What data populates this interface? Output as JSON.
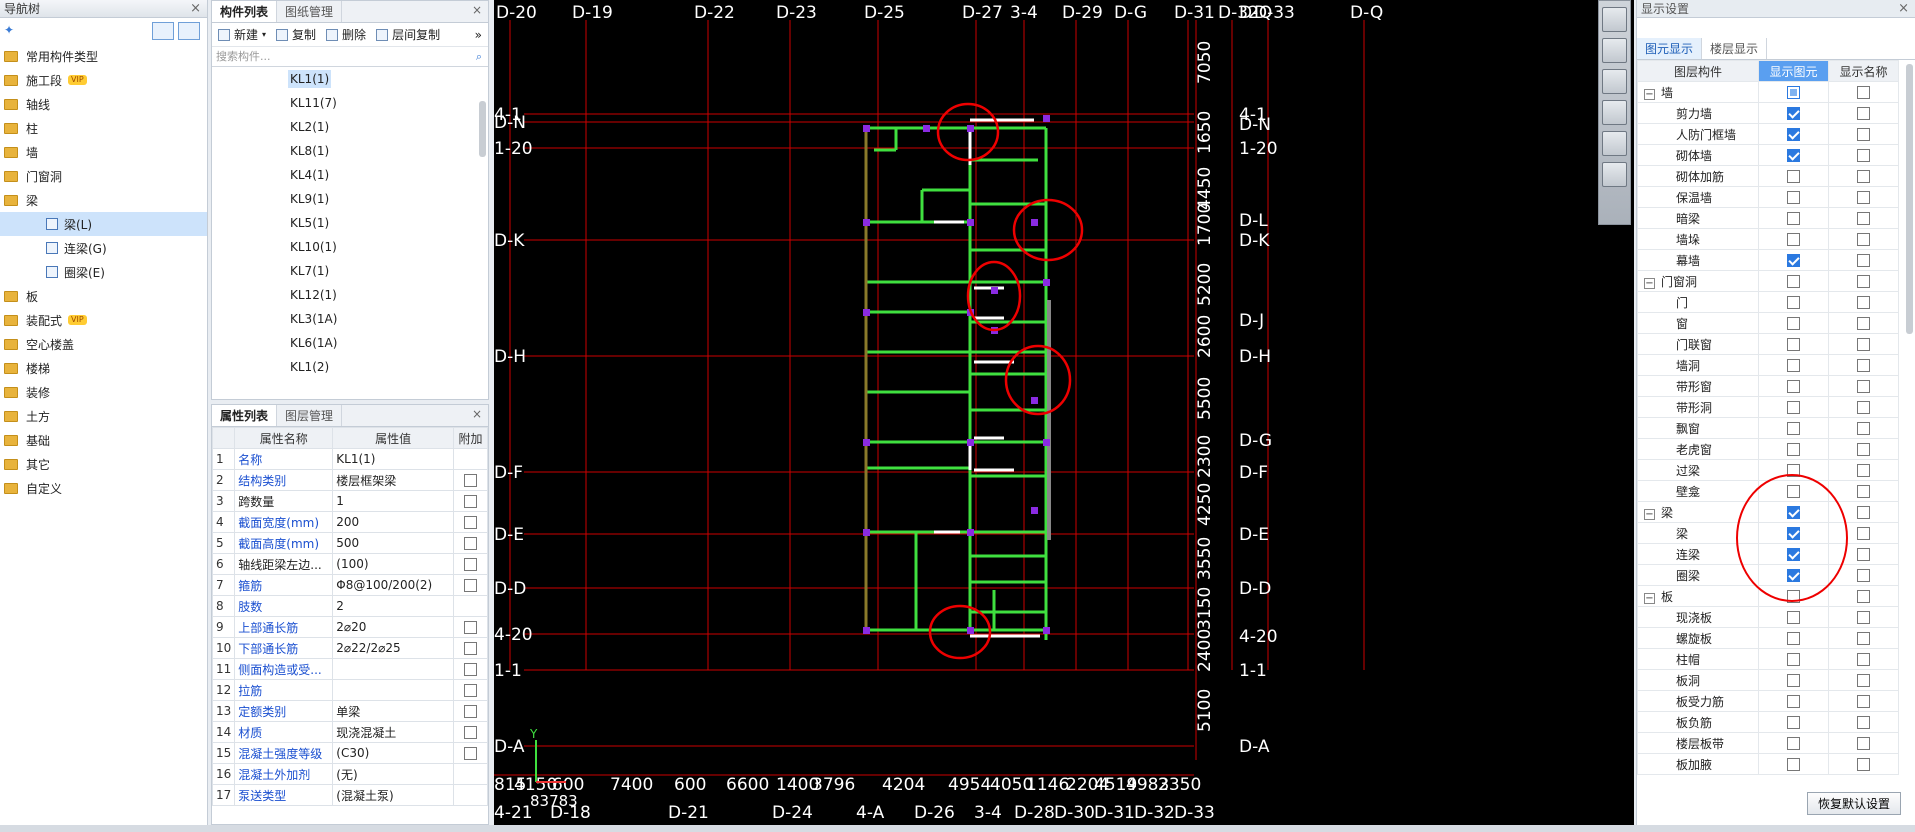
{
  "nav": {
    "title": "导航树",
    "items": [
      {
        "label": "常用构件类型"
      },
      {
        "label": "施工段",
        "badge": "VIP"
      },
      {
        "label": "轴线"
      },
      {
        "label": "柱"
      },
      {
        "label": "墙"
      },
      {
        "label": "门窗洞"
      },
      {
        "label": "梁"
      },
      {
        "label": "梁(L)"
      },
      {
        "label": "连梁(G)"
      },
      {
        "label": "圈梁(E)"
      },
      {
        "label": "板"
      },
      {
        "label": "装配式",
        "badge": "VIP"
      },
      {
        "label": "空心楼盖"
      },
      {
        "label": "楼梯"
      },
      {
        "label": "装修"
      },
      {
        "label": "土方"
      },
      {
        "label": "基础"
      },
      {
        "label": "其它"
      },
      {
        "label": "自定义"
      }
    ]
  },
  "components": {
    "tabs": [
      "构件列表",
      "图纸管理"
    ],
    "toolbar": {
      "new": "新建",
      "copy": "复制",
      "delete": "删除",
      "floor_copy": "层间复制"
    },
    "search_placeholder": "搜索构件...",
    "items": [
      "KL1(1)",
      "KL11(7)",
      "KL2(1)",
      "KL8(1)",
      "KL4(1)",
      "KL9(1)",
      "KL5(1)",
      "KL10(1)",
      "KL7(1)",
      "KL12(1)",
      "KL3(1A)",
      "KL6(1A)",
      "KL1(2)"
    ]
  },
  "properties": {
    "tabs": [
      "属性列表",
      "图层管理"
    ],
    "headers": [
      "属性名称",
      "属性值",
      "附加"
    ],
    "rows": [
      {
        "n": "1",
        "k": "名称",
        "v": "KL1(1)",
        "cb": false
      },
      {
        "n": "2",
        "k": "结构类别",
        "v": "楼层框架梁",
        "cb": true
      },
      {
        "n": "3",
        "k": "跨数量",
        "v": "1",
        "cb": true
      },
      {
        "n": "4",
        "k": "截面宽度(mm)",
        "v": "200",
        "cb": true
      },
      {
        "n": "5",
        "k": "截面高度(mm)",
        "v": "500",
        "cb": true
      },
      {
        "n": "6",
        "k": "轴线距梁左边...",
        "v": "(100)",
        "cb": true
      },
      {
        "n": "7",
        "k": "箍筋",
        "v": "Φ8@100/200(2)",
        "cb": true
      },
      {
        "n": "8",
        "k": "肢数",
        "v": "2",
        "cb": false
      },
      {
        "n": "9",
        "k": "上部通长筋",
        "v": "2⌀20",
        "cb": true
      },
      {
        "n": "10",
        "k": "下部通长筋",
        "v": "2⌀22/2⌀25",
        "cb": true
      },
      {
        "n": "11",
        "k": "侧面构造或受...",
        "v": "",
        "cb": true
      },
      {
        "n": "12",
        "k": "拉筋",
        "v": "",
        "cb": true
      },
      {
        "n": "13",
        "k": "定额类别",
        "v": "单梁",
        "cb": true
      },
      {
        "n": "14",
        "k": "材质",
        "v": "现浇混凝土",
        "cb": true
      },
      {
        "n": "15",
        "k": "混凝土强度等级",
        "v": "(C30)",
        "cb": true
      },
      {
        "n": "16",
        "k": "混凝土外加剂",
        "v": "(无)",
        "cb": false
      },
      {
        "n": "17",
        "k": "泵送类型",
        "v": "(混凝土泵)",
        "cb": false
      }
    ]
  },
  "canvas": {
    "top_axes": [
      "D-20",
      "D-19",
      "D-22",
      "D-23",
      "D-25",
      "D-27",
      "3-4",
      "D-29",
      "D-G",
      "D-31",
      "D-32",
      "D-33",
      "D-Q"
    ],
    "left_axes": [
      "4-1",
      "D-N",
      "1-20",
      "D-K",
      "D-H",
      "D-F",
      "D-E",
      "D-D",
      "4-20",
      "1-1",
      "D-A"
    ],
    "right_axes": [
      "D-Q",
      "4-1",
      "D-N",
      "1-20",
      "D-L",
      "D-K",
      "D-J",
      "D-H",
      "D-G",
      "D-F",
      "D-E",
      "D-D",
      "4-20",
      "1-1",
      "D-A"
    ],
    "right_dims": [
      "7050",
      "1650",
      "4450",
      "1700",
      "5200",
      "2600",
      "5500",
      "2300",
      "4250",
      "3550",
      "3150",
      "2400",
      "5100"
    ],
    "bottom_dims": [
      "815",
      "4150",
      "600",
      "7400",
      "600",
      "6600",
      "1400",
      "3796",
      "4204",
      "4954",
      "4050",
      "1146",
      "2204",
      "4519",
      "4983",
      "2350"
    ],
    "bottom_total": "83783",
    "bottom_axes": [
      "4-21",
      "D-18",
      "D-21",
      "D-24",
      "4-A",
      "D-26",
      "3-4",
      "D-28",
      "D-30",
      "D-31",
      "D-32",
      "D-33"
    ]
  },
  "display": {
    "title": "显示设置",
    "tabs": [
      "图元显示",
      "楼层显示"
    ],
    "headers": [
      "图层构件",
      "显示图元",
      "显示名称"
    ],
    "rows": [
      {
        "label": "墙",
        "group": true,
        "show": "partial",
        "name": false
      },
      {
        "label": "剪力墙",
        "show": true,
        "name": false
      },
      {
        "label": "人防门框墙",
        "show": true,
        "name": false
      },
      {
        "label": "砌体墙",
        "show": true,
        "name": false
      },
      {
        "label": "砌体加筋",
        "show": false,
        "name": false
      },
      {
        "label": "保温墙",
        "show": false,
        "name": false
      },
      {
        "label": "暗梁",
        "show": false,
        "name": false
      },
      {
        "label": "墙垛",
        "show": false,
        "name": false
      },
      {
        "label": "幕墙",
        "show": true,
        "name": false
      },
      {
        "label": "门窗洞",
        "group": true,
        "show": false,
        "name": false
      },
      {
        "label": "门",
        "show": false,
        "name": false
      },
      {
        "label": "窗",
        "show": false,
        "name": false
      },
      {
        "label": "门联窗",
        "show": false,
        "name": false
      },
      {
        "label": "墙洞",
        "show": false,
        "name": false
      },
      {
        "label": "带形窗",
        "show": false,
        "name": false
      },
      {
        "label": "带形洞",
        "show": false,
        "name": false
      },
      {
        "label": "飘窗",
        "show": false,
        "name": false
      },
      {
        "label": "老虎窗",
        "show": false,
        "name": false
      },
      {
        "label": "过梁",
        "show": false,
        "name": false
      },
      {
        "label": "壁龛",
        "show": false,
        "name": false
      },
      {
        "label": "梁",
        "group": true,
        "show": true,
        "name": false
      },
      {
        "label": "梁",
        "show": true,
        "name": false
      },
      {
        "label": "连梁",
        "show": true,
        "name": false
      },
      {
        "label": "圈梁",
        "show": true,
        "name": false
      },
      {
        "label": "板",
        "group": true,
        "show": false,
        "name": false
      },
      {
        "label": "现浇板",
        "show": false,
        "name": false
      },
      {
        "label": "螺旋板",
        "show": false,
        "name": false
      },
      {
        "label": "柱帽",
        "show": false,
        "name": false
      },
      {
        "label": "板洞",
        "show": false,
        "name": false
      },
      {
        "label": "板受力筋",
        "show": false,
        "name": false
      },
      {
        "label": "板负筋",
        "show": false,
        "name": false
      },
      {
        "label": "楼层板带",
        "show": false,
        "name": false
      },
      {
        "label": "板加腋",
        "show": false,
        "name": false
      }
    ],
    "reset": "恢复默认设置"
  }
}
